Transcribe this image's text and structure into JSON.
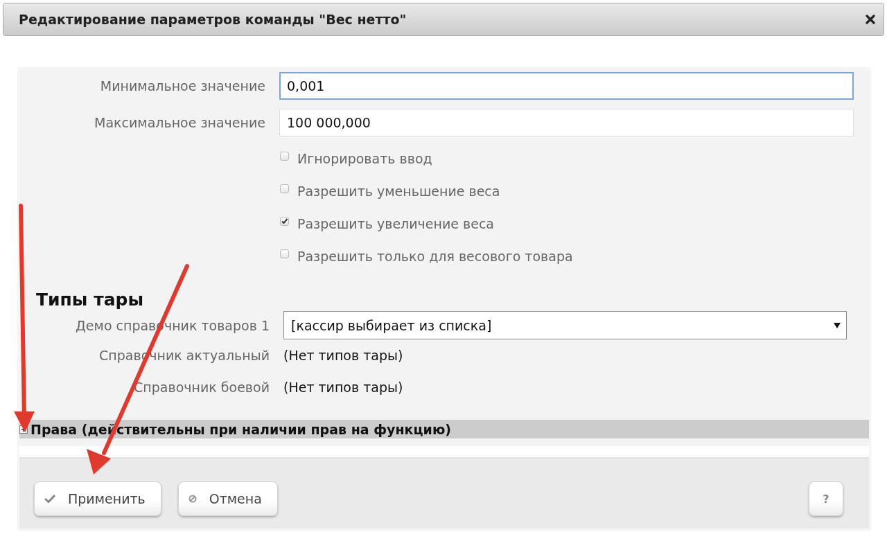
{
  "dialog": {
    "title": "Редактирование параметров команды \"Вес нетто\""
  },
  "fields": [
    {
      "label": "Минимальное значение",
      "value": "0,001",
      "focused": true
    },
    {
      "label": "Максимальное значение",
      "value": "100 000,000",
      "focused": false
    }
  ],
  "checkboxes": [
    {
      "label": "Игнорировать ввод",
      "checked": false
    },
    {
      "label": "Разрешить уменьшение веса",
      "checked": false
    },
    {
      "label": "Разрешить увеличение веса",
      "checked": true
    },
    {
      "label": "Разрешить только для весового товара",
      "checked": false
    }
  ],
  "tare_types": {
    "title": "Типы тары",
    "rows": [
      {
        "label": "Демо справочник товаров 1",
        "kind": "select",
        "value": "[кассир выбирает из списка]"
      },
      {
        "label": "Справочник актуальный",
        "kind": "text",
        "value": "(Нет типов тары)"
      },
      {
        "label": "Справочник боевой",
        "kind": "text",
        "value": "(Нет типов тары)"
      }
    ]
  },
  "rights_section": {
    "title": "Права (действительны при наличии прав на функцию)",
    "expanded": false
  },
  "buttons": [
    {
      "label": "Применить",
      "kind": "apply"
    },
    {
      "label": "Отмена",
      "kind": "cancel"
    },
    {
      "label": "?",
      "kind": "help"
    }
  ]
}
